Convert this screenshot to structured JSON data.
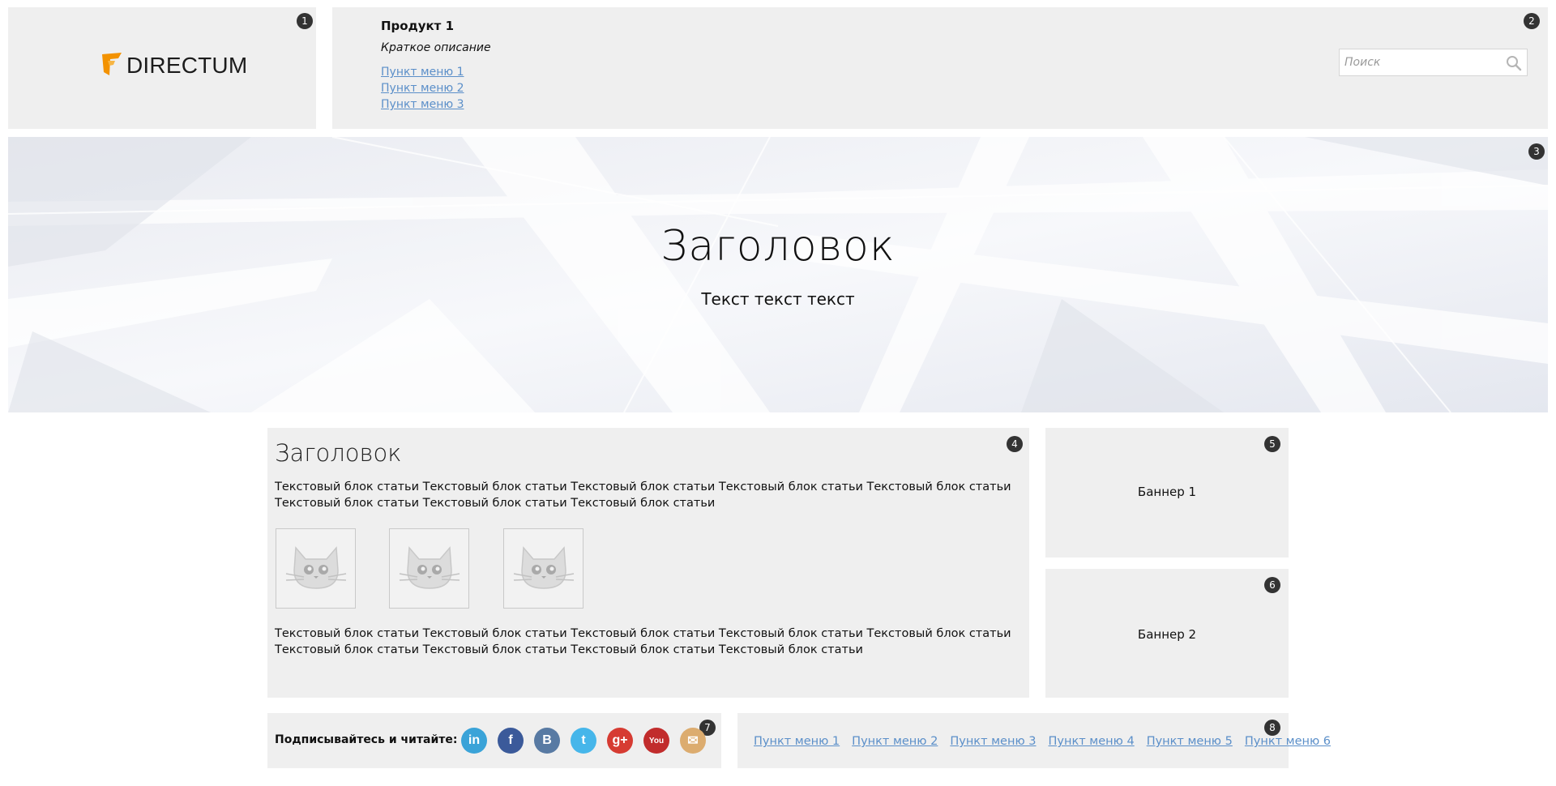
{
  "badges": {
    "b1": "1",
    "b2": "2",
    "b3": "3",
    "b4": "4",
    "b5": "5",
    "b6": "6",
    "b7": "7",
    "b8": "8"
  },
  "logo": {
    "text": "DIRECTUM",
    "icon": "directum-logo-icon",
    "accent": "#f39200"
  },
  "header": {
    "product_title": "Продукт 1",
    "product_desc": "Краткое описание",
    "menu": [
      "Пункт меню 1",
      "Пункт меню 2",
      "Пункт меню 3"
    ],
    "search_placeholder": "Поиск"
  },
  "hero": {
    "title": "Заголовок",
    "text": "Текст текст текст"
  },
  "article": {
    "title": "Заголовок",
    "text1": "Текстовый блок статьи Текстовый блок статьи Текстовый блок статьи Текстовый блок статьи Текстовый блок статьи Текстовый блок статьи Текстовый блок статьи Текстовый блок статьи",
    "text2": "Текстовый блок статьи Текстовый блок статьи Текстовый блок статьи Текстовый блок статьи Текстовый блок статьи Текстовый блок статьи Текстовый блок статьи Текстовый блок статьи Текстовый блок статьи",
    "thumb_icon": "cat-placeholder-icon"
  },
  "banners": {
    "b1": "Баннер 1",
    "b2": "Баннер 2"
  },
  "social": {
    "label": "Подписывайтесь и читайте:",
    "icons": [
      {
        "name": "linkedin-icon",
        "glyph": "in",
        "color": "#3aa3d8"
      },
      {
        "name": "facebook-icon",
        "glyph": "f",
        "color": "#3b5a9a"
      },
      {
        "name": "vkontakte-icon",
        "glyph": "B",
        "color": "#587aa3"
      },
      {
        "name": "twitter-icon",
        "glyph": "t",
        "color": "#46b6ea"
      },
      {
        "name": "google-plus-icon",
        "glyph": "g+",
        "color": "#d63b32"
      },
      {
        "name": "youtube-icon",
        "glyph": "You",
        "color": "#c12c2c"
      },
      {
        "name": "email-icon",
        "glyph": "✉",
        "color": "#dcac6f"
      }
    ]
  },
  "footer_menu": [
    "Пункт меню 1",
    "Пункт меню 2",
    "Пункт меню 3",
    "Пункт меню 4",
    "Пункт меню 5",
    "Пункт меню 6"
  ]
}
